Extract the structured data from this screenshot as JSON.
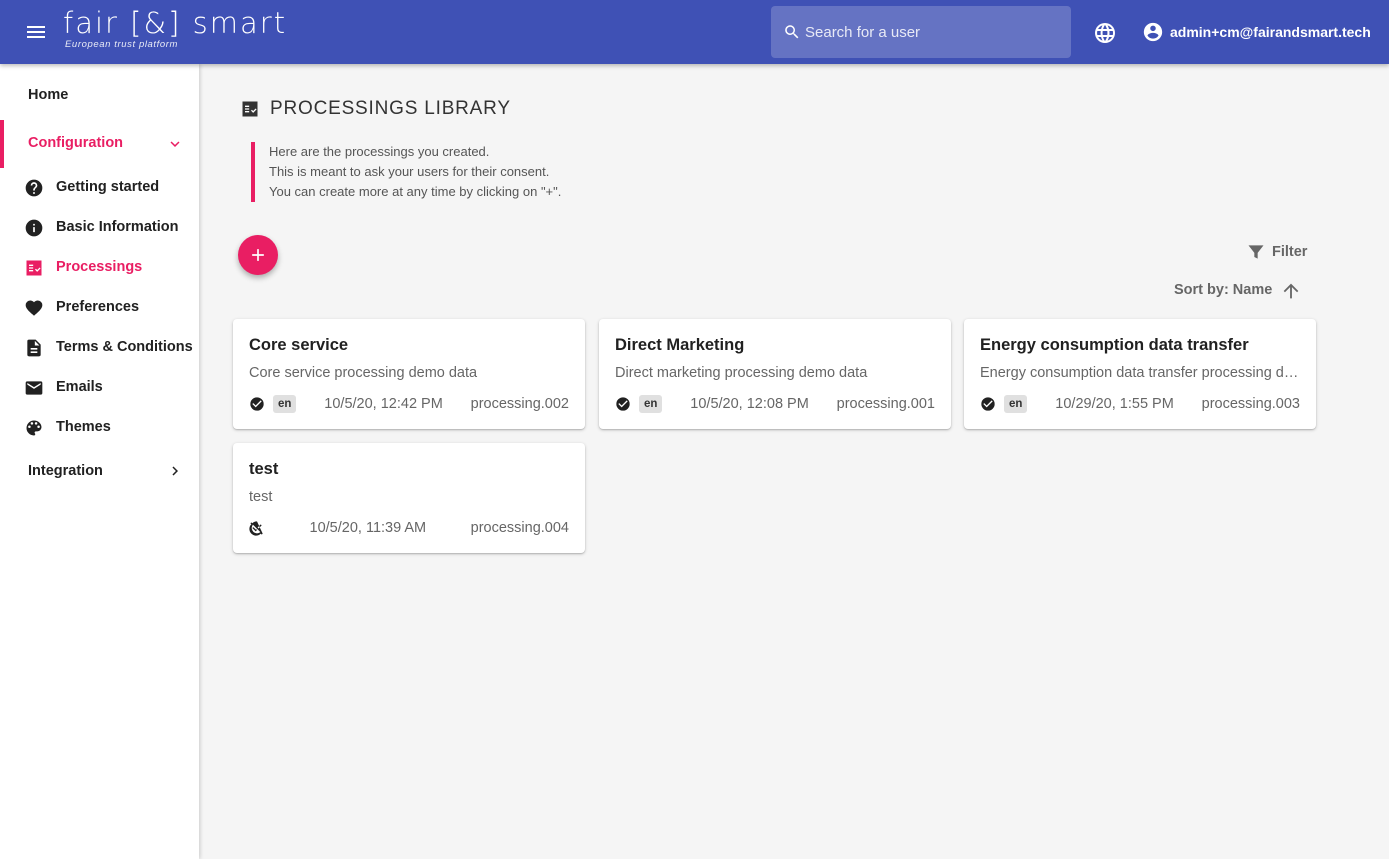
{
  "header": {
    "logo_text": "fair [&] smart",
    "logo_tagline": "European trust platform",
    "search_placeholder": "Search for a user",
    "user_email": "admin+cm@fairandsmart.tech",
    "background_color": "#3f51b5",
    "icons": [
      "menu-icon",
      "search-icon",
      "globe-icon",
      "account-circle-icon"
    ]
  },
  "sidebar": {
    "home": "Home",
    "configuration": "Configuration",
    "items": [
      {
        "label": "Getting started",
        "icon": "help-circle-icon"
      },
      {
        "label": "Basic Information",
        "icon": "info-icon"
      },
      {
        "label": "Processings",
        "icon": "processings-icon",
        "active": true
      },
      {
        "label": "Preferences",
        "icon": "heart-icon"
      },
      {
        "label": "Terms & Conditions",
        "icon": "document-icon"
      },
      {
        "label": "Emails",
        "icon": "mail-icon"
      },
      {
        "label": "Themes",
        "icon": "palette-icon"
      }
    ],
    "integration": "Integration",
    "accent_color": "#e91e63"
  },
  "main": {
    "title": "PROCESSINGS LIBRARY",
    "intro": [
      "Here are the processings you created.",
      "This is meant to ask your users for their consent.",
      "You can create more at any time by clicking on \"+\"."
    ],
    "filter_label": "Filter",
    "sort_label": "Sort by: Name",
    "cards": [
      {
        "title": "Core service",
        "description": "Core service processing demo data",
        "lang": "en",
        "date": "10/5/20, 12:42 PM",
        "code": "processing.002",
        "status": "published"
      },
      {
        "title": "Direct Marketing",
        "description": "Direct marketing processing demo data",
        "lang": "en",
        "date": "10/5/20, 12:08 PM",
        "code": "processing.001",
        "status": "published"
      },
      {
        "title": "Energy consumption data transfer",
        "description": "Energy consumption data transfer processing demo data",
        "lang": "en",
        "date": "10/29/20, 1:55 PM",
        "code": "processing.003",
        "status": "published"
      },
      {
        "title": "test",
        "description": "test",
        "lang": "",
        "date": "10/5/20, 11:39 AM",
        "code": "processing.004",
        "status": "draft"
      }
    ]
  }
}
